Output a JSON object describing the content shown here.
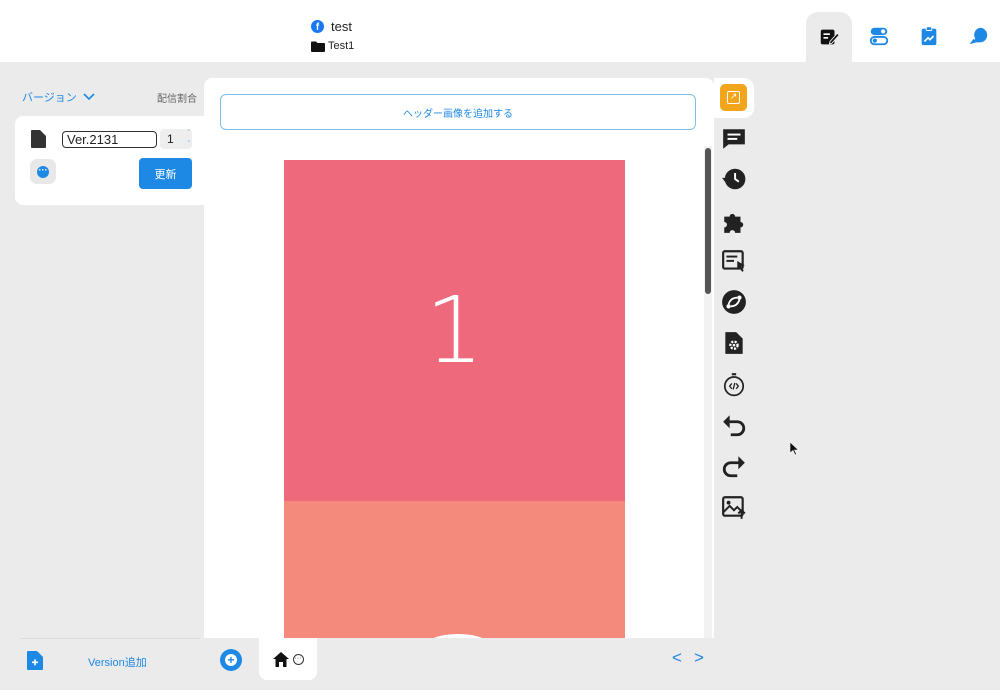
{
  "header": {
    "project_name": "test",
    "folder_name": "Test1",
    "nav_tabs": [
      {
        "icon": "edit-icon",
        "active": true
      },
      {
        "icon": "toggle-icon",
        "active": false
      },
      {
        "icon": "analytics-clipboard-icon",
        "active": false
      },
      {
        "icon": "chat-bubble-icon",
        "active": false
      }
    ]
  },
  "sidebar": {
    "version_label": "バージョン",
    "distribution_label": "配信割合",
    "version_card": {
      "version_value": "Ver.2131",
      "ratio_value": "1",
      "update_button_label": "更新"
    },
    "add_version_label": "Version追加"
  },
  "editor": {
    "add_header_label": "ヘッダー画像を追加する",
    "slide_1_text": "1"
  },
  "page_nav": {
    "prev_label": "<",
    "next_label": ">"
  },
  "colors": {
    "accent": "#1e88e5",
    "slide_1": "#ef697c",
    "slide_2": "#f38a7c",
    "toolbar_highlight": "#f2a41b"
  }
}
